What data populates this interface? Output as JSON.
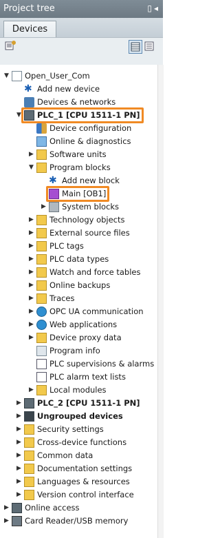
{
  "panel": {
    "title": "Project tree",
    "tab": "Devices"
  },
  "tree": {
    "rows": [
      {
        "label": "Open_User_Com",
        "level": 0,
        "expander": "open",
        "icon": "project-icon",
        "bold": false
      },
      {
        "label": "Add new device",
        "level": 1,
        "expander": "none",
        "icon": "add-device-icon",
        "bold": false
      },
      {
        "label": "Devices & networks",
        "level": 1,
        "expander": "none",
        "icon": "network-icon",
        "bold": false
      },
      {
        "label": "PLC_1 [CPU 1511-1 PN]",
        "level": 1,
        "expander": "open",
        "icon": "plc-icon",
        "bold": true,
        "highlight": true
      },
      {
        "label": "Device configuration",
        "level": 2,
        "expander": "none",
        "icon": "device-config-icon",
        "bold": false
      },
      {
        "label": "Online & diagnostics",
        "level": 2,
        "expander": "none",
        "icon": "diagnostics-icon",
        "bold": false
      },
      {
        "label": "Software units",
        "level": 2,
        "expander": "closed",
        "icon": "folder-icon",
        "bold": false
      },
      {
        "label": "Program blocks",
        "level": 2,
        "expander": "open",
        "icon": "folder-icon",
        "bold": false
      },
      {
        "label": "Add new block",
        "level": 3,
        "expander": "none",
        "icon": "add-block-icon",
        "bold": false
      },
      {
        "label": "Main [OB1]",
        "level": 3,
        "expander": "none",
        "icon": "ob-block-icon",
        "bold": false,
        "highlight": true
      },
      {
        "label": "System blocks",
        "level": 3,
        "expander": "closed",
        "icon": "system-blocks-icon",
        "bold": false
      },
      {
        "label": "Technology objects",
        "level": 2,
        "expander": "closed",
        "icon": "folder-icon",
        "bold": false
      },
      {
        "label": "External source files",
        "level": 2,
        "expander": "closed",
        "icon": "folder-icon",
        "bold": false
      },
      {
        "label": "PLC tags",
        "level": 2,
        "expander": "closed",
        "icon": "folder-icon",
        "bold": false
      },
      {
        "label": "PLC data types",
        "level": 2,
        "expander": "closed",
        "icon": "folder-icon",
        "bold": false
      },
      {
        "label": "Watch and force tables",
        "level": 2,
        "expander": "closed",
        "icon": "folder-icon",
        "bold": false
      },
      {
        "label": "Online backups",
        "level": 2,
        "expander": "closed",
        "icon": "folder-icon",
        "bold": false
      },
      {
        "label": "Traces",
        "level": 2,
        "expander": "closed",
        "icon": "folder-icon",
        "bold": false
      },
      {
        "label": "OPC UA communication",
        "level": 2,
        "expander": "closed",
        "icon": "globe-icon",
        "bold": false
      },
      {
        "label": "Web applications",
        "level": 2,
        "expander": "closed",
        "icon": "globe-icon",
        "bold": false
      },
      {
        "label": "Device proxy data",
        "level": 2,
        "expander": "closed",
        "icon": "folder-icon",
        "bold": false
      },
      {
        "label": "Program info",
        "level": 2,
        "expander": "none",
        "icon": "program-info-icon",
        "bold": false
      },
      {
        "label": "PLC supervisions & alarms",
        "level": 2,
        "expander": "none",
        "icon": "alarms-icon",
        "bold": false
      },
      {
        "label": "PLC alarm text lists",
        "level": 2,
        "expander": "none",
        "icon": "text-list-icon",
        "bold": false
      },
      {
        "label": "Local modules",
        "level": 2,
        "expander": "closed",
        "icon": "folder-icon",
        "bold": false
      },
      {
        "label": "PLC_2 [CPU 1511-1 PN]",
        "level": 1,
        "expander": "closed",
        "icon": "plc-icon",
        "bold": true
      },
      {
        "label": "Ungrouped devices",
        "level": 1,
        "expander": "closed",
        "icon": "ungrouped-icon",
        "bold": true
      },
      {
        "label": "Security settings",
        "level": 1,
        "expander": "closed",
        "icon": "security-icon",
        "bold": false
      },
      {
        "label": "Cross-device functions",
        "level": 1,
        "expander": "closed",
        "icon": "cross-device-icon",
        "bold": false
      },
      {
        "label": "Common data",
        "level": 1,
        "expander": "closed",
        "icon": "common-data-icon",
        "bold": false
      },
      {
        "label": "Documentation settings",
        "level": 1,
        "expander": "closed",
        "icon": "documentation-icon",
        "bold": false
      },
      {
        "label": "Languages & resources",
        "level": 1,
        "expander": "closed",
        "icon": "languages-icon",
        "bold": false
      },
      {
        "label": "Version control interface",
        "level": 1,
        "expander": "closed",
        "icon": "version-control-icon",
        "bold": false
      },
      {
        "label": "Online access",
        "level": 0,
        "expander": "closed",
        "icon": "online-access-icon",
        "bold": false
      },
      {
        "label": "Card Reader/USB memory",
        "level": 0,
        "expander": "closed",
        "icon": "card-reader-icon",
        "bold": false
      }
    ]
  },
  "colors": {
    "highlight": "#f08a24",
    "titlebar": "#6d7a84"
  }
}
